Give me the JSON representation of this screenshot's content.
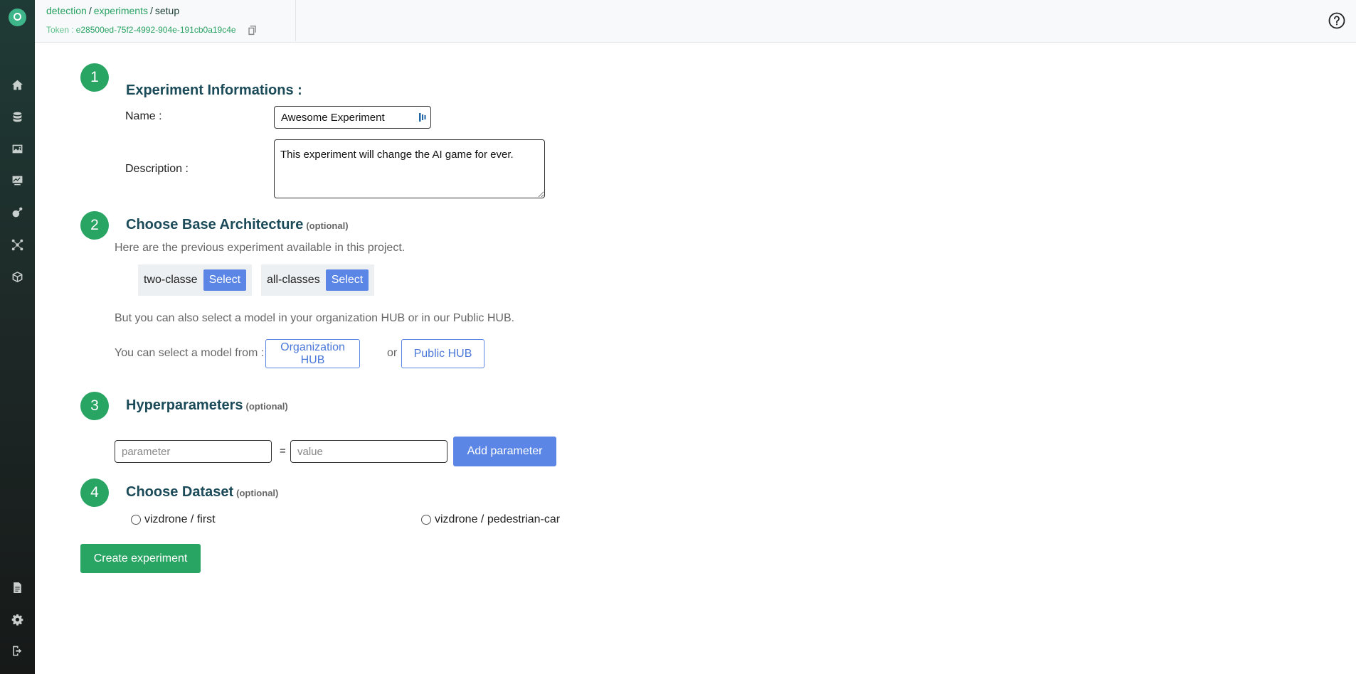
{
  "breadcrumb": {
    "items": [
      "detection",
      "experiments"
    ],
    "separator": "/",
    "current": "setup"
  },
  "token": {
    "label": "Token :",
    "value": "e28500ed-75f2-4992-904e-191cb0a19c4e"
  },
  "sidebar": {
    "icons": [
      "home-icon",
      "database-icon",
      "image-icon",
      "chart-icon",
      "robot-icon",
      "network-icon",
      "box-icon"
    ],
    "bottom_icons": [
      "document-icon",
      "gear-icon",
      "logout-icon"
    ]
  },
  "steps": {
    "s1": {
      "number": "1",
      "title": "Experiment Informations :"
    },
    "s2": {
      "number": "2",
      "title": "Choose Base Architecture",
      "optional": "(optional)"
    },
    "s3": {
      "number": "3",
      "title": "Hyperparameters",
      "optional": "(optional)"
    },
    "s4": {
      "number": "4",
      "title": "Choose Dataset",
      "optional": "(optional)"
    }
  },
  "form": {
    "name_label": "Name :",
    "name_value": "Awesome Experiment",
    "description_label": "Description :",
    "description_value": "This experiment will change the AI game for ever."
  },
  "architecture": {
    "intro": "Here are the previous experiment available in this project.",
    "experiments": [
      {
        "name": "two-classe",
        "button": "Select"
      },
      {
        "name": "all-classes",
        "button": "Select"
      }
    ],
    "hub_text": "But you can also select a model in your organization HUB or in our Public HUB.",
    "select_from": "You can select a model from :",
    "org_hub": "Organization HUB",
    "or": "or",
    "public_hub": "Public HUB"
  },
  "hyperparameters": {
    "param_placeholder": "parameter",
    "equals": "=",
    "value_placeholder": "value",
    "add_button": "Add parameter"
  },
  "datasets": [
    "vizdrone / first",
    "vizdrone / pedestrian-car"
  ],
  "create_button": "Create experiment",
  "colors": {
    "primary_green": "#28a463",
    "accent_blue": "#5b86e5",
    "title_blue": "#1b4a58"
  }
}
